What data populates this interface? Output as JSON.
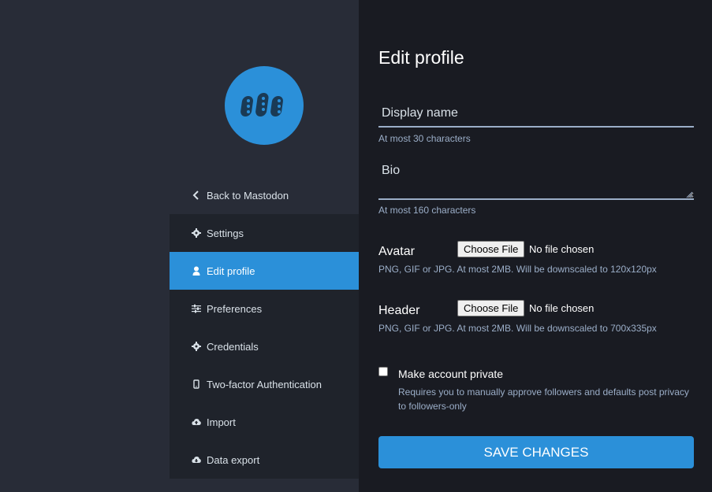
{
  "sidebar": {
    "back_label": "Back to Mastodon",
    "items": [
      {
        "label": "Settings",
        "icon": "gear-icon"
      },
      {
        "label": "Edit profile",
        "icon": "user-icon",
        "active": true
      },
      {
        "label": "Preferences",
        "icon": "sliders-icon"
      },
      {
        "label": "Credentials",
        "icon": "gear-icon"
      },
      {
        "label": "Two-factor Authentication",
        "icon": "mobile-icon"
      },
      {
        "label": "Import",
        "icon": "cloud-upload-icon"
      },
      {
        "label": "Data export",
        "icon": "cloud-download-icon"
      }
    ]
  },
  "form": {
    "title": "Edit profile",
    "display_name": {
      "placeholder": "Display name",
      "value": "",
      "hint": "At most 30 characters"
    },
    "bio": {
      "placeholder": "Bio",
      "value": "",
      "hint": "At most 160 characters"
    },
    "avatar": {
      "label": "Avatar",
      "button": "Choose File",
      "status": "No file chosen",
      "hint": "PNG, GIF or JPG. At most 2MB. Will be downscaled to 120x120px"
    },
    "header": {
      "label": "Header",
      "button": "Choose File",
      "status": "No file chosen",
      "hint": "PNG, GIF or JPG. At most 2MB. Will be downscaled to 700x335px"
    },
    "private": {
      "label": "Make account private",
      "hint": "Requires you to manually approve followers and defaults post privacy to followers-only",
      "checked": false
    },
    "save_label": "SAVE CHANGES"
  },
  "colors": {
    "accent": "#2b90d9",
    "sidebar_bg": "#282c37",
    "nav_bg": "#1f232b",
    "main_bg": "#191b22",
    "hint_text": "#9baec8"
  }
}
